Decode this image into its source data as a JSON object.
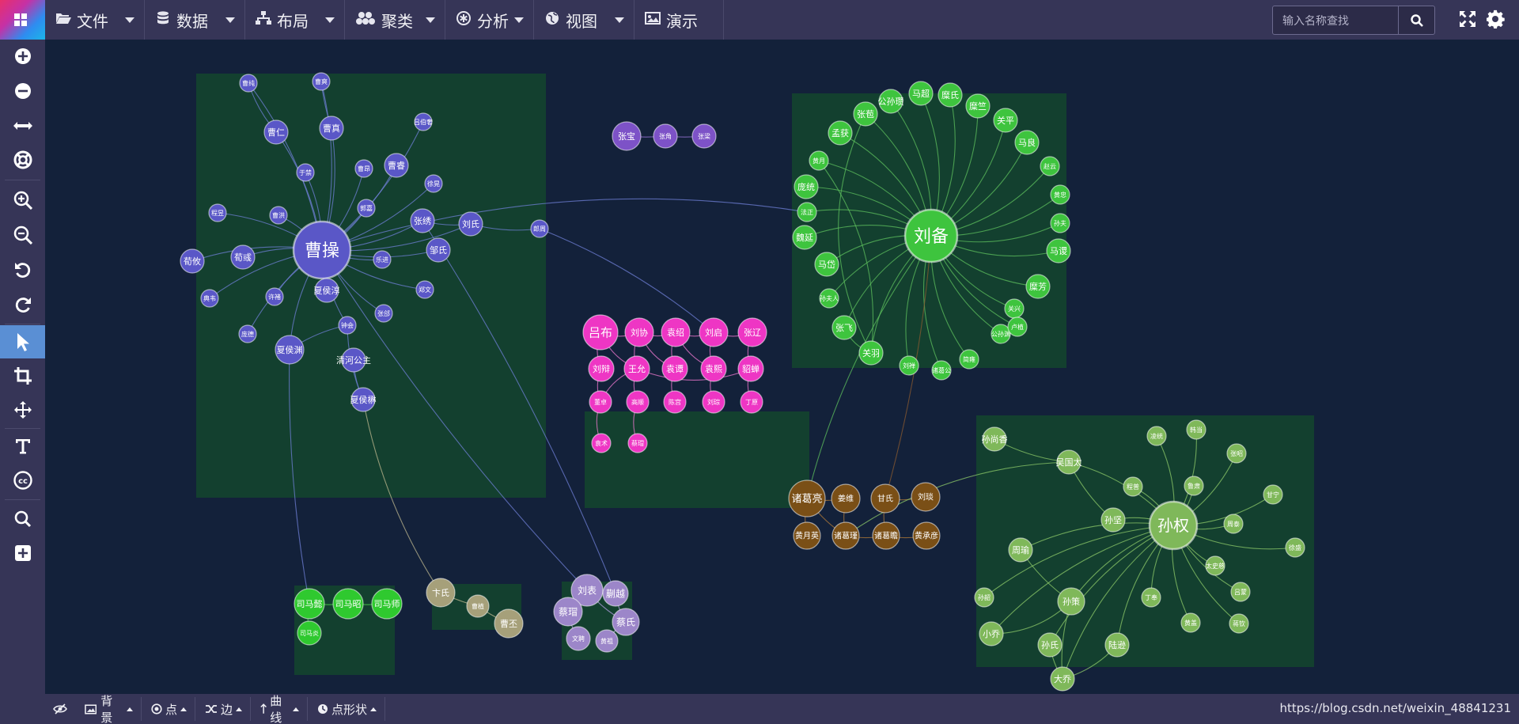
{
  "toolbar": {
    "menus": [
      {
        "id": "file",
        "label": "文件",
        "icon": "folder-open-icon"
      },
      {
        "id": "data",
        "label": "数据",
        "icon": "database-icon"
      },
      {
        "id": "layout",
        "label": "布局",
        "icon": "sitemap-icon"
      },
      {
        "id": "cluster",
        "label": "聚类",
        "icon": "cubes-icon"
      },
      {
        "id": "analysis",
        "label": "分析",
        "icon": "asterisk-icon"
      },
      {
        "id": "view",
        "label": "视图",
        "icon": "globe-icon"
      },
      {
        "id": "present",
        "label": "演示",
        "icon": "image-icon"
      }
    ],
    "search_placeholder": "输入名称查找"
  },
  "sidebar": {
    "tools": [
      "plus-circle-icon",
      "minus-circle-icon",
      "arrows-h-icon",
      "life-ring-icon",
      "zoom-in-icon",
      "zoom-out-icon",
      "undo-icon",
      "redo-icon",
      "pointer-icon",
      "crop-icon",
      "move-icon",
      "text-icon",
      "cc-icon",
      "search-icon",
      "add-box-icon"
    ],
    "active": "pointer-icon"
  },
  "bottombar": {
    "items": [
      {
        "id": "bg",
        "label": "背景",
        "icon": "image-icon"
      },
      {
        "id": "node",
        "label": "点",
        "icon": "dot-circle-icon"
      },
      {
        "id": "edge",
        "label": "边",
        "icon": "random-icon"
      },
      {
        "id": "curve",
        "label": "曲线",
        "icon": "arrow-up-icon"
      },
      {
        "id": "shape",
        "label": "点形状",
        "icon": "shape-icon"
      }
    ],
    "stats_text": "https://blog.csdn.net/weixin_48841231"
  },
  "graph": {
    "colors": {
      "purple": "#5a57c7",
      "green": "#3ec43e",
      "pink": "#ee36c4",
      "brown": "#7a4f16",
      "olive": "#7fb85a",
      "lavender": "#9c86c9",
      "tan": "#a6a07a",
      "violet": "#7d52c7",
      "brightgreen": "#2fc92f",
      "bg": "#13213a",
      "cluster": "#13402f"
    },
    "hubs": {
      "caocao": "曹操",
      "liubei": "刘备",
      "sunquan": "孙权"
    },
    "groups": {
      "cao": [
        "曹纯",
        "曹爽",
        "吕伯奢",
        "曹仁",
        "曹真",
        "曹睿",
        "于禁",
        "曹昂",
        "徐晃",
        "郭嘉",
        "程昱",
        "曹洪",
        "张绣",
        "刘氏",
        "荀彧",
        "荀攸",
        "乐进",
        "邹氏",
        "典韦",
        "许褚",
        "夏侯淳",
        "郑文",
        "张郃",
        "庞德",
        "夏侯渊",
        "钟会",
        "清河公主",
        "夏侯楙",
        "郎周"
      ],
      "liu": [
        "公孙瓒",
        "马超",
        "糜氏",
        "张苞",
        "糜竺",
        "孟获",
        "关平",
        "黄月",
        "马良",
        "赵云",
        "庞统",
        "黄忠",
        "孙夫",
        "法正",
        "马谡",
        "魏延",
        "马岱",
        "孙夫人",
        "糜芳",
        "关兴",
        "张飞",
        "关羽",
        "刘禅",
        "诸葛公",
        "简雍",
        "公孙渊",
        "卢植"
      ],
      "lu": [
        "吕布",
        "刘协",
        "袁绍",
        "刘启",
        "张辽",
        "刘辩",
        "王允",
        "袁谭",
        "袁熙",
        "貂蝉",
        "董卓",
        "高顺",
        "陈宫",
        "刘琮",
        "丁原",
        "袁术",
        "蔡瑁"
      ],
      "sun": [
        "孙尚香",
        "凌统",
        "韩当",
        "张昭",
        "程普",
        "吴国太",
        "鲁肃",
        "甘宁",
        "孙坚",
        "周泰",
        "徐盛",
        "周瑜",
        "太史慈",
        "吕蒙",
        "孙韶",
        "孙策",
        "丁奉",
        "黄盖",
        "蒋钦",
        "小乔",
        "孙氏",
        "陆逊",
        "大乔"
      ],
      "zhuge": [
        "诸葛亮",
        "姜维",
        "甘氏",
        "刘琰",
        "黄月英",
        "诸葛瑾",
        "诸葛瞻",
        "黄承彦"
      ],
      "zhang": [
        "张宝",
        "张角",
        "张梁"
      ],
      "sima": [
        "司马懿",
        "司马昭",
        "司马师",
        "司马炎"
      ],
      "bian": [
        "卞氏",
        "曹植",
        "曹丕"
      ],
      "liubiao": [
        "刘表",
        "蒯越",
        "蔡瑁",
        "蔡氏",
        "文聘",
        "黄祖"
      ]
    }
  }
}
